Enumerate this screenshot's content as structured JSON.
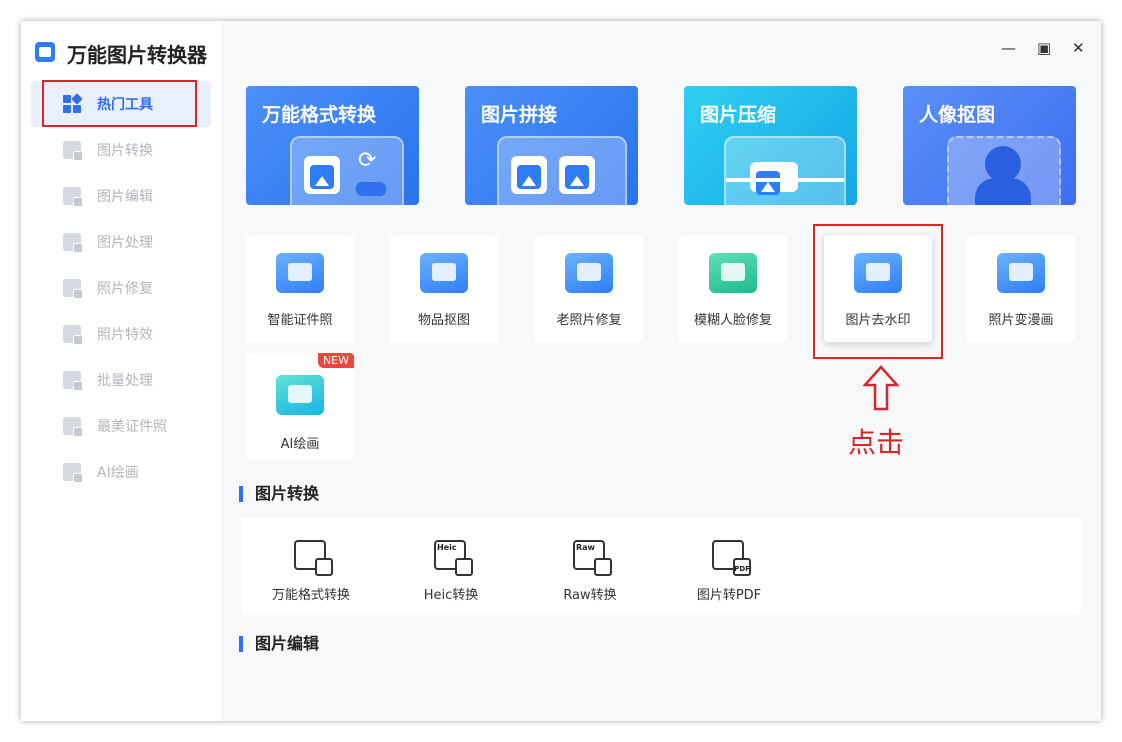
{
  "app": {
    "title": "万能图片转换器"
  },
  "window_controls": {
    "minimize": "—",
    "maximize": "▣",
    "close": "✕"
  },
  "sidebar": {
    "items": [
      {
        "label": "热门工具",
        "icon": "hot-tools-icon"
      },
      {
        "label": "图片转换",
        "icon": "image-convert-icon"
      },
      {
        "label": "图片编辑",
        "icon": "image-edit-icon"
      },
      {
        "label": "图片处理",
        "icon": "image-process-icon"
      },
      {
        "label": "照片修复",
        "icon": "photo-repair-icon"
      },
      {
        "label": "照片特效",
        "icon": "photo-effect-icon"
      },
      {
        "label": "批量处理",
        "icon": "batch-process-icon"
      },
      {
        "label": "最美证件照",
        "icon": "id-photo-icon"
      },
      {
        "label": "AI绘画",
        "icon": "ai-draw-icon"
      }
    ]
  },
  "banners": [
    {
      "title": "万能格式转换",
      "color": "#3a86f5"
    },
    {
      "title": "图片拼接",
      "color": "#3a86f5"
    },
    {
      "title": "图片压缩",
      "color": "#17b8e8"
    },
    {
      "title": "人像抠图",
      "color": "#4b7ef4"
    }
  ],
  "tools": [
    {
      "label": "智能证件照"
    },
    {
      "label": "物品抠图"
    },
    {
      "label": "老照片修复"
    },
    {
      "label": "模糊人脸修复"
    },
    {
      "label": "图片去水印"
    },
    {
      "label": "照片变漫画"
    },
    {
      "label": "AI绘画",
      "badge": "NEW"
    }
  ],
  "sections": {
    "convert_title": "图片转换",
    "edit_title": "图片编辑"
  },
  "conversions": [
    {
      "label": "万能格式转换",
      "tag": ""
    },
    {
      "label": "Heic转换",
      "tag": "Heic"
    },
    {
      "label": "Raw转换",
      "tag": "Raw"
    },
    {
      "label": "图片转PDF",
      "tag": "PDF"
    }
  ],
  "annotation": {
    "text": "点击",
    "color": "#d52828"
  }
}
